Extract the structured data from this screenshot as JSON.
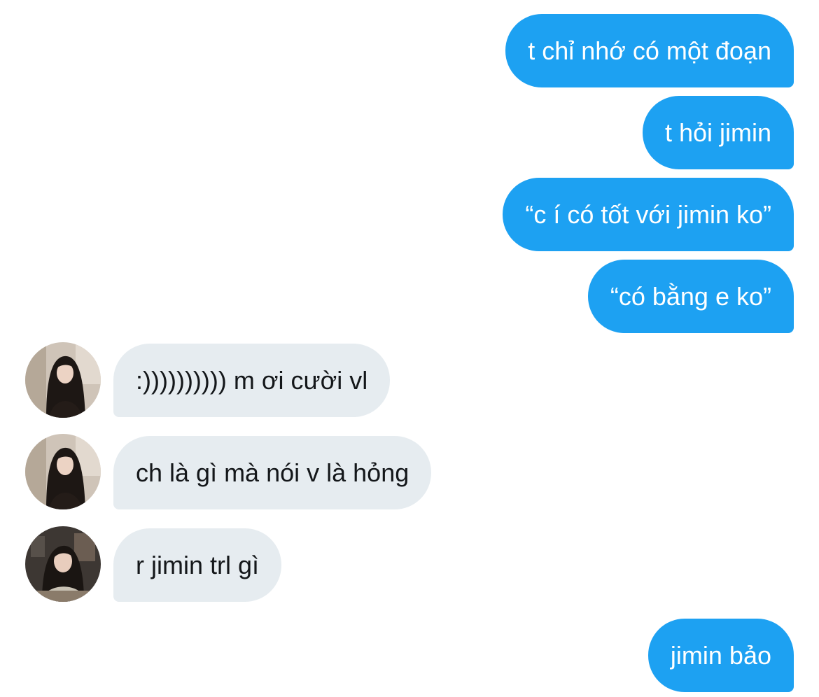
{
  "conversation": {
    "messages": [
      {
        "sender": "me",
        "text": "t chỉ nhớ có một đoạn"
      },
      {
        "sender": "me",
        "text": "t hỏi jimin"
      },
      {
        "sender": "me",
        "text": "“c í có tốt với jimin ko”"
      },
      {
        "sender": "me",
        "text": "“có bằng e ko”"
      },
      {
        "sender": "other",
        "avatar": "avatar-dark-hair",
        "text": ":)))))))))) m ơi cười vl"
      },
      {
        "sender": "other",
        "avatar": "avatar-dark-hair",
        "text": "ch là gì mà nói v là hỏng"
      },
      {
        "sender": "other",
        "avatar": "avatar-cafe",
        "text": "r jimin trl gì"
      },
      {
        "sender": "me",
        "text": "jimin bảo"
      }
    ]
  },
  "colors": {
    "sent_bubble": "#1da1f2",
    "received_bubble": "#e6ecf0",
    "sent_text": "#ffffff",
    "received_text": "#14171a"
  }
}
